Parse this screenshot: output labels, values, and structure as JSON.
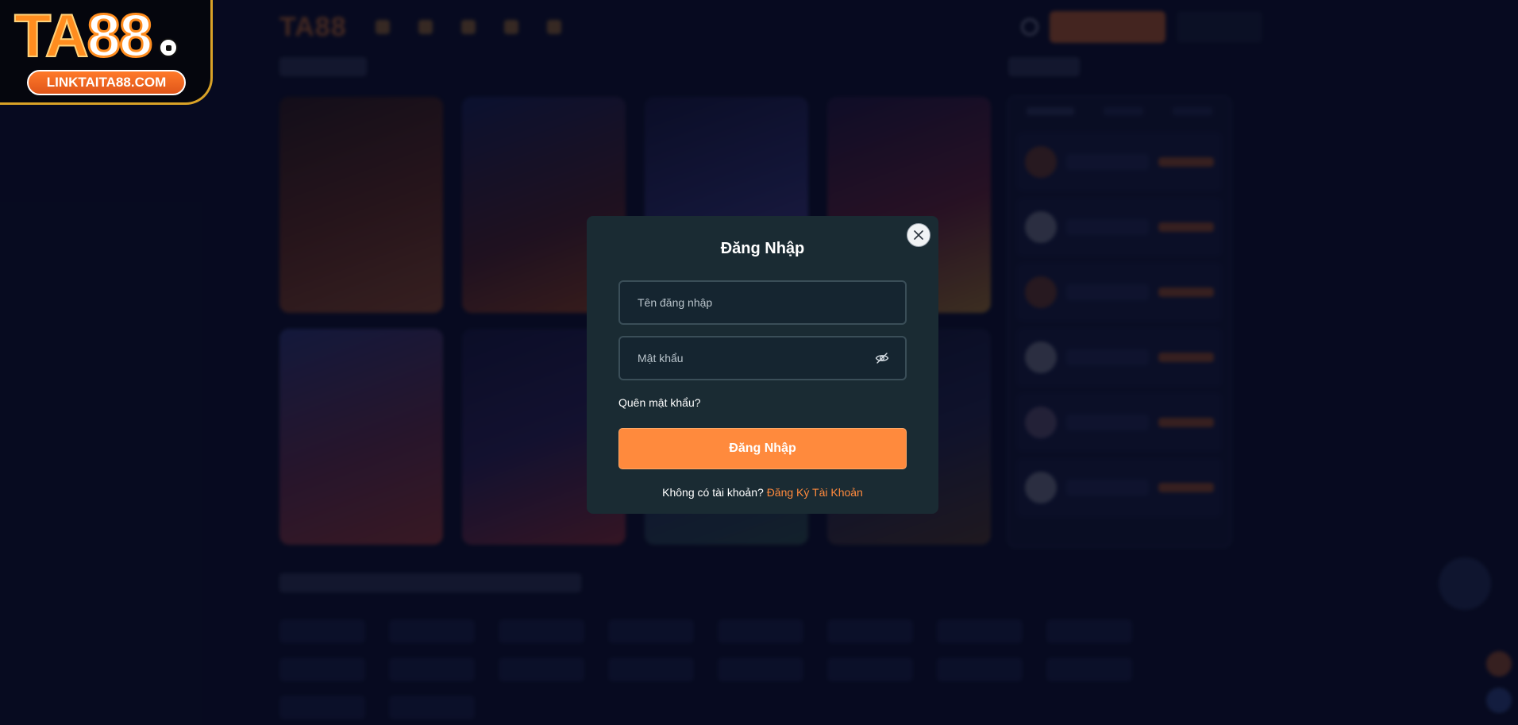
{
  "logo": {
    "brand_ta": "TA",
    "brand_88": "88",
    "url_badge": "LINKTAITA88.COM"
  },
  "modal": {
    "title": "Đăng Nhập",
    "username_placeholder": "Tên đăng nhập",
    "password_placeholder": "Mật khẩu",
    "forgot_password": "Quên mật khẩu?",
    "submit_label": "Đăng Nhập",
    "no_account_text": "Không có tài khoản?",
    "register_link": "Đăng Ký Tài Khoản",
    "close_icon": "close-icon",
    "password_toggle_icon": "eye-off-icon"
  },
  "colors": {
    "accent": "#ff8a3d",
    "modal_bg": "#1a2b33",
    "page_bg": "#0a0f2a"
  }
}
